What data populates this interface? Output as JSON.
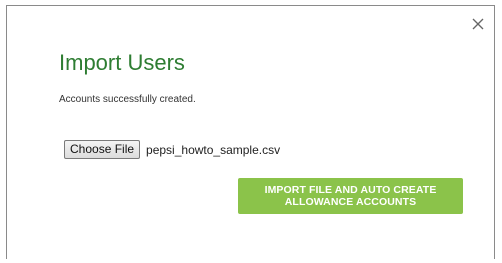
{
  "dialog": {
    "title": "Import Users",
    "status_message": "Accounts successfully created.",
    "close_icon": "close-icon",
    "file_input": {
      "button_label": "Choose File",
      "selected_file": "pepsi_howto_sample.csv"
    },
    "import_button": {
      "line1": "IMPORT FILE AND AUTO CREATE",
      "line2": "ALLOWANCE ACCOUNTS"
    }
  },
  "colors": {
    "title": "#2e7d32",
    "import_button_bg": "#8bc34a",
    "border": "#8a8a8a"
  }
}
